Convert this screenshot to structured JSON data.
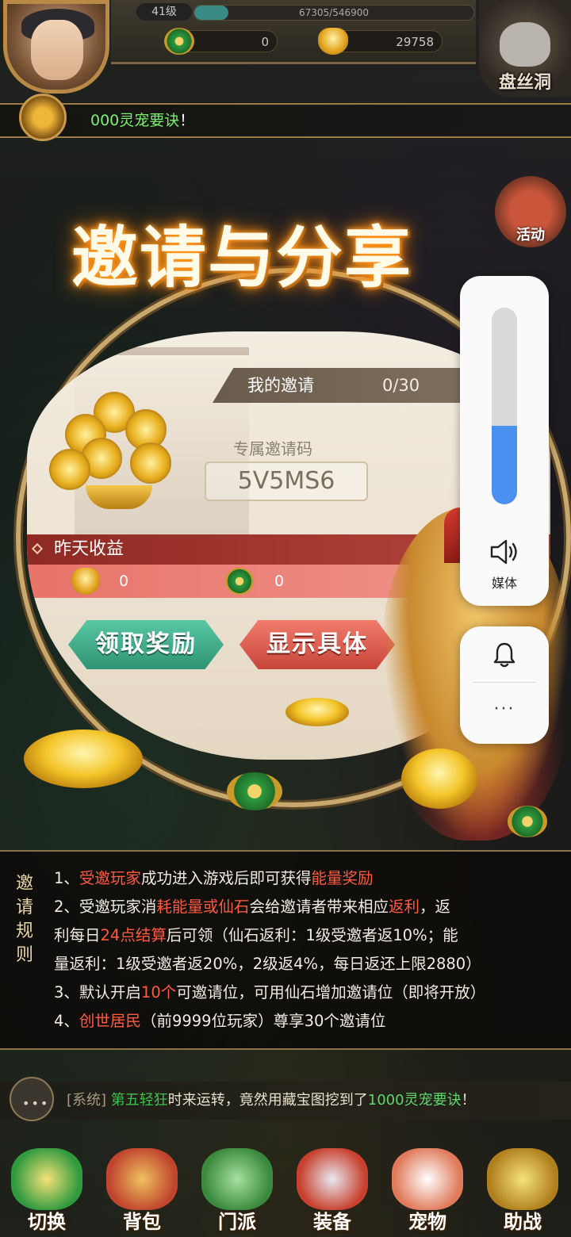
{
  "hud": {
    "level": "41级",
    "exp": "67305/546900",
    "exp_fraction": 0.123,
    "currency_green": "0",
    "currency_gold": "29758",
    "dungeon_label": "盘丝洞",
    "event_label": "活动"
  },
  "notice": {
    "text": "000灵宠要诀",
    "suffix": "！"
  },
  "invite": {
    "title": "邀请与分享",
    "my_invites_label": "我的邀请",
    "my_invites_count": "0/30",
    "code_label": "专属邀请码",
    "code": "5V5MS6",
    "yesterday_label": "昨天收益",
    "earn_gold": "0",
    "earn_green": "0",
    "claim_button": "领取奖励",
    "detail_button": "显示具体"
  },
  "rules": {
    "title": "邀请规则",
    "r1_a": "1、",
    "r1_b": "受邀玩家",
    "r1_c": "成功进入游戏后即可获得",
    "r1_d": "能量奖励",
    "r2_a": "2、受邀玩家消",
    "r2_b": "耗能量或仙石",
    "r2_c": "会给邀请者带来相应",
    "r2_d": "返利",
    "r2_e": "，返",
    "r2_f": "利每日",
    "r2_g": "24点结算",
    "r2_h": "后可领（仙石返利：1级受邀者返10%；能",
    "r2_i": "量返利：1级受邀者返20%，2级返4%，每日返还上限2880）",
    "r3_a": "3、默认开启",
    "r3_b": "10个",
    "r3_c": "可邀请位，可用仙石增加邀请位（即将开放）",
    "r4_a": "4、",
    "r4_b": "创世居民",
    "r4_c": "（前9999位玩家）尊享30个邀请位"
  },
  "chat": {
    "channel": "[系统]",
    "player": "第五轻狂",
    "text": "时来运转，竟然用藏宝图挖到了",
    "item": "1000灵宠要诀",
    "end": "！"
  },
  "bottom_nav": {
    "switch": "切换",
    "bag": "背包",
    "sect": "门派",
    "equip": "装备",
    "pet": "宠物",
    "assist": "助战"
  },
  "volume": {
    "label": "媒体",
    "level": 0.4,
    "more": "···",
    "accent": "#4a90f0"
  }
}
